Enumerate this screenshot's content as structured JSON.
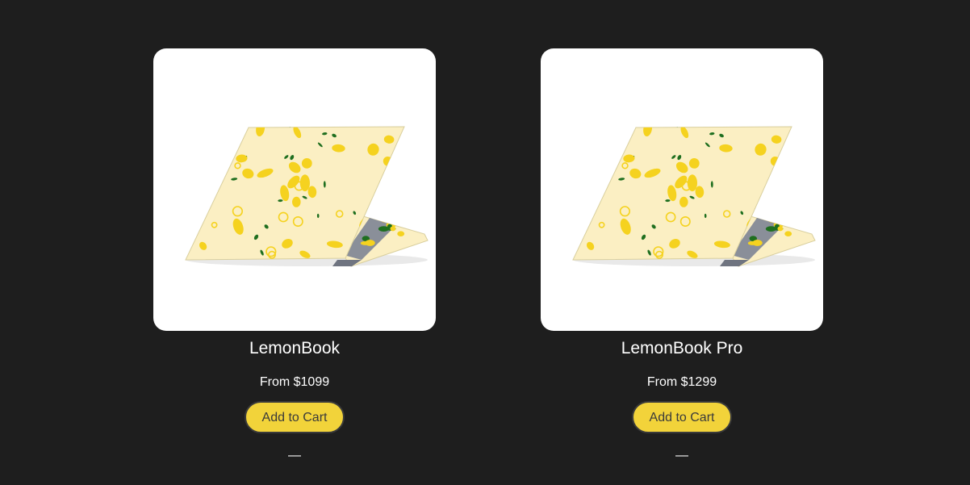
{
  "colors": {
    "page_background": "#1e1e1e",
    "card_background": "#ffffff",
    "button_background": "#f2d33a",
    "button_text": "#3a3a3a",
    "lemon_skin": "#fbefc3",
    "lemon": "#f5d21f",
    "leaf": "#1f6f1f"
  },
  "products": [
    {
      "name": "LemonBook",
      "price": "From $1099",
      "button_label": "Add to Cart",
      "quantity": "—",
      "image_icon": "laptop-lemon-skin-image"
    },
    {
      "name": "LemonBook Pro",
      "price": "From $1299",
      "button_label": "Add to Cart",
      "quantity": "—",
      "image_icon": "laptop-lemon-skin-image"
    }
  ]
}
